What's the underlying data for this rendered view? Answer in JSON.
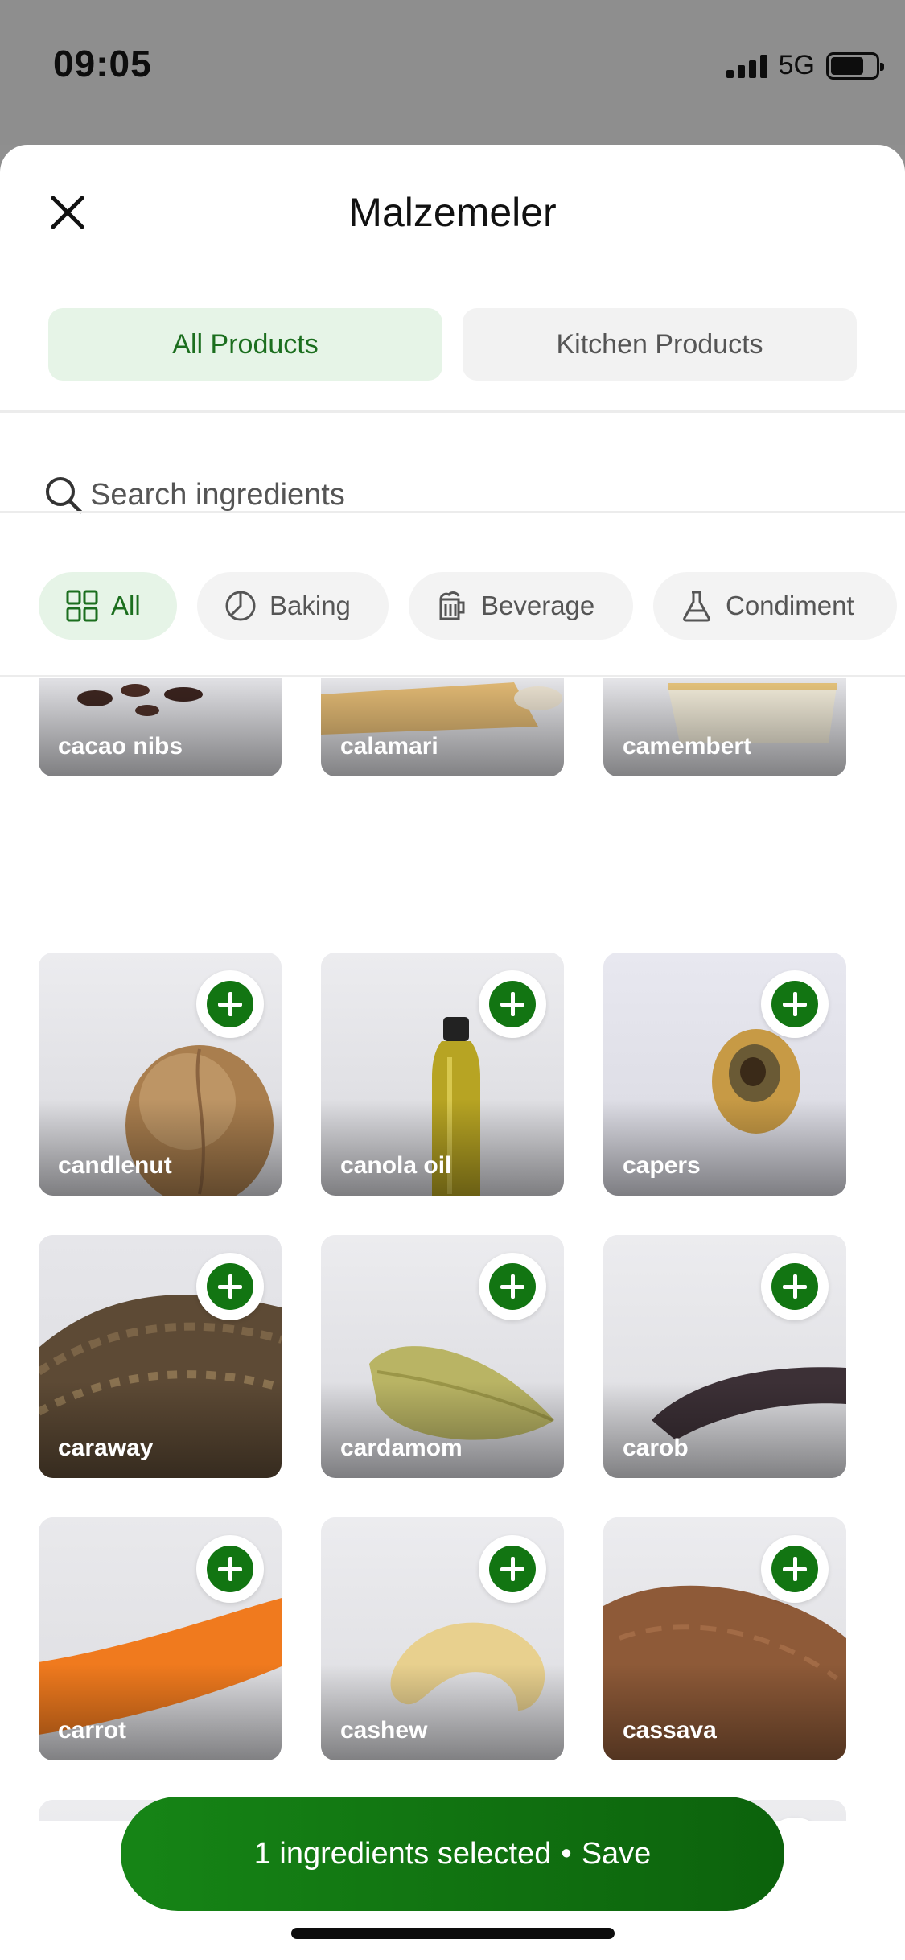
{
  "status_bar": {
    "time": "09:05",
    "network": "5G",
    "battery_level": 0.74
  },
  "sheet": {
    "title": "Malzemeler"
  },
  "tabs": [
    {
      "label": "All Products",
      "active": true
    },
    {
      "label": "Kitchen Products",
      "active": false
    }
  ],
  "search": {
    "placeholder": "Search ingredients"
  },
  "categories": [
    {
      "label": "All",
      "icon": "grid-icon",
      "active": true
    },
    {
      "label": "Baking",
      "icon": "pie-icon",
      "active": false
    },
    {
      "label": "Beverage",
      "icon": "beer-mug-icon",
      "active": false
    },
    {
      "label": "Condiment",
      "icon": "flask-icon",
      "active": false
    }
  ],
  "ingredients": [
    {
      "name": "cacao nibs"
    },
    {
      "name": "calamari"
    },
    {
      "name": "camembert"
    },
    {
      "name": "candlenut"
    },
    {
      "name": "canola oil"
    },
    {
      "name": "capers"
    },
    {
      "name": "caraway"
    },
    {
      "name": "cardamom"
    },
    {
      "name": "carob"
    },
    {
      "name": "carrot"
    },
    {
      "name": "cashew"
    },
    {
      "name": "cassava"
    },
    {
      "name": ""
    },
    {
      "name": ""
    },
    {
      "name": ""
    }
  ],
  "save_bar": {
    "count_text": "1 ingredients selected",
    "separator": "•",
    "action": "Save"
  },
  "colors": {
    "accent": "#127512",
    "accent_light": "#e6f4e7"
  }
}
